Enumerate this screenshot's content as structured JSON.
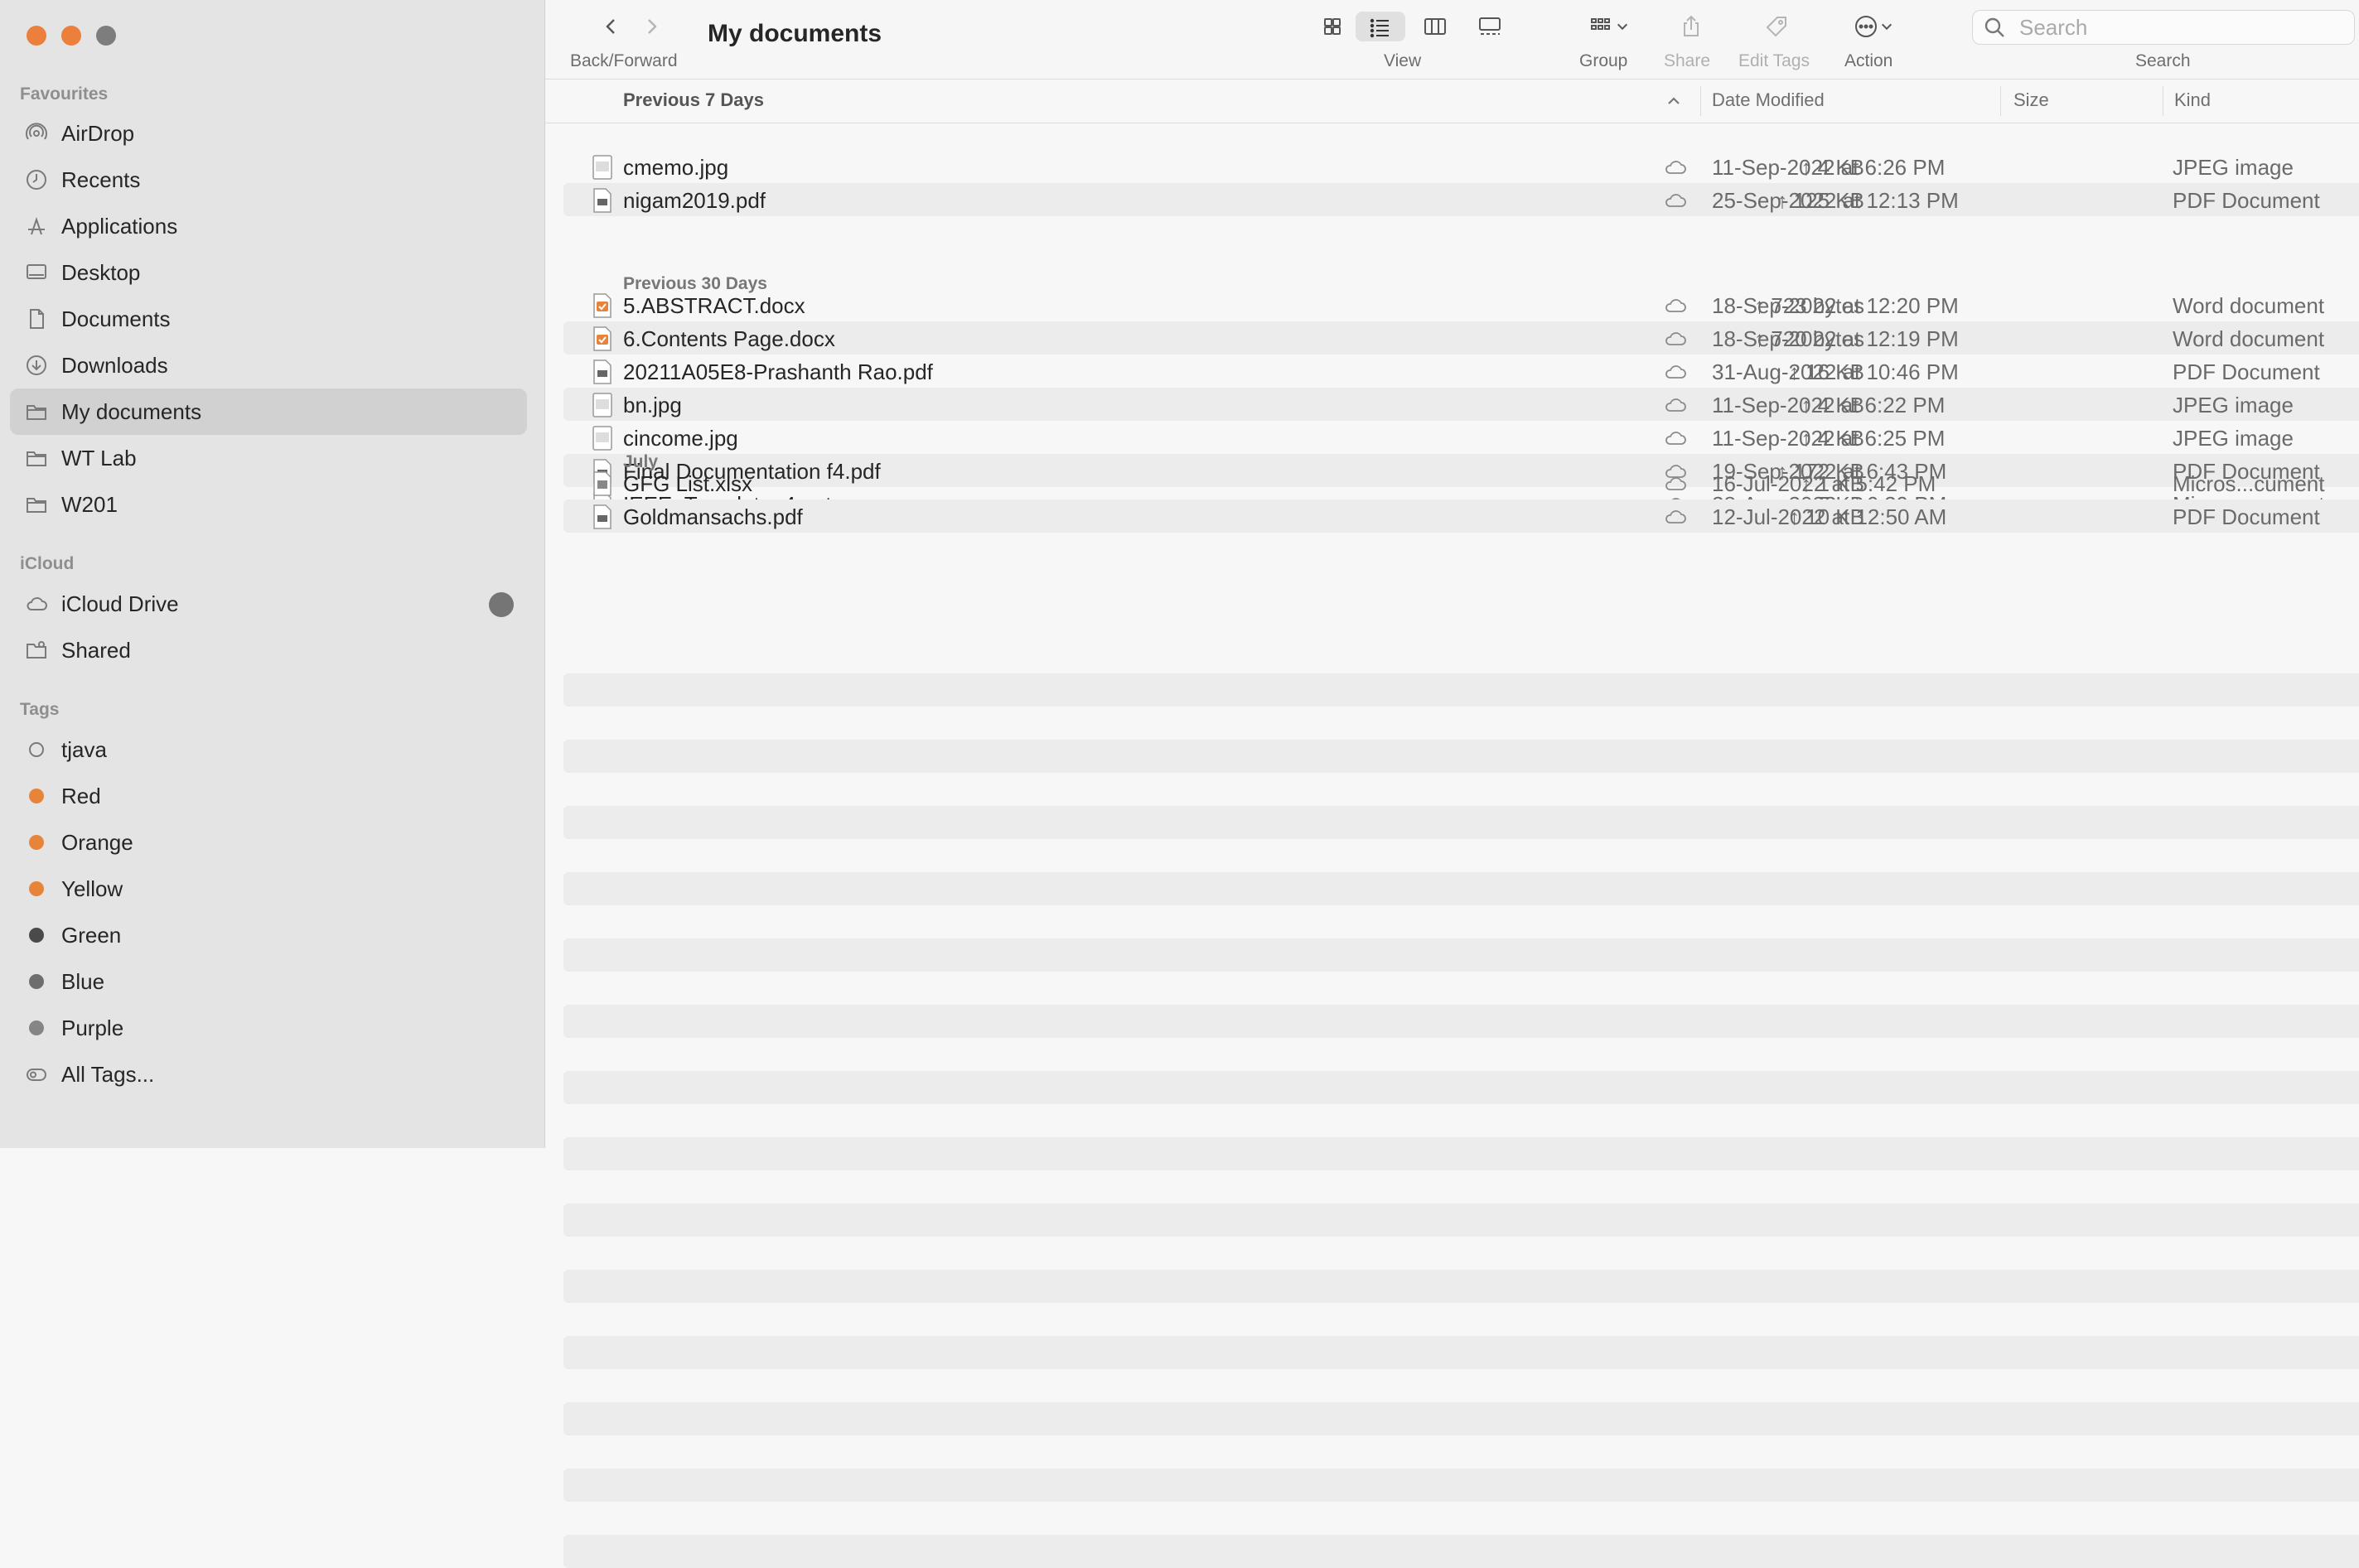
{
  "window": {
    "title": "My documents",
    "traffic_lights": [
      "close",
      "minimize",
      "zoom"
    ]
  },
  "sidebar": {
    "favourites_label": "Favourites",
    "favourites": [
      {
        "label": "AirDrop",
        "icon": "airdrop-icon"
      },
      {
        "label": "Recents",
        "icon": "clock-icon"
      },
      {
        "label": "Applications",
        "icon": "applications-icon"
      },
      {
        "label": "Desktop",
        "icon": "desktop-icon"
      },
      {
        "label": "Documents",
        "icon": "document-icon"
      },
      {
        "label": "Downloads",
        "icon": "download-icon"
      },
      {
        "label": "My documents",
        "icon": "folder-icon",
        "selected": true
      },
      {
        "label": "WT Lab",
        "icon": "folder-icon"
      },
      {
        "label": "W201",
        "icon": "folder-icon"
      }
    ],
    "icloud_label": "iCloud",
    "icloud": [
      {
        "label": "iCloud Drive",
        "icon": "cloud-icon"
      },
      {
        "label": "Shared",
        "icon": "shared-folder-icon"
      }
    ],
    "tags_label": "Tags",
    "tags": [
      {
        "label": "tjava",
        "color": "hollow"
      },
      {
        "label": "Red",
        "color": "#e8833a"
      },
      {
        "label": "Orange",
        "color": "#e8833a"
      },
      {
        "label": "Yellow",
        "color": "#e8833a"
      },
      {
        "label": "Green",
        "color": "#4a4a4a"
      },
      {
        "label": "Blue",
        "color": "#6e6e6e"
      },
      {
        "label": "Purple",
        "color": "#858585"
      },
      {
        "label": "All Tags...",
        "color": "all"
      }
    ]
  },
  "toolbar": {
    "back_forward_label": "Back/Forward",
    "view_label": "View",
    "group_label": "Group",
    "share_label": "Share",
    "edit_tags_label": "Edit Tags",
    "action_label": "Action",
    "search_label": "Search",
    "search_placeholder": "Search",
    "active_view": "list"
  },
  "columns": {
    "name": "Previous 7 Days",
    "date": "Date Modified",
    "size": "Size",
    "kind": "Kind"
  },
  "groups": [
    {
      "label": "Previous 7 Days",
      "files": [
        {
          "name": "cmemo.jpg",
          "date": "11-Sep-2022 at 6:26 PM",
          "size": "↑ 4 KB",
          "kind": "JPEG image",
          "icon": "image-file-icon"
        },
        {
          "name": "nigam2019.pdf",
          "date": "25-Sep-2022 at 12:13 PM",
          "size": "↑ 125 KB",
          "kind": "PDF Document",
          "icon": "pdf-file-icon"
        }
      ]
    },
    {
      "label": "Previous 30 Days",
      "files": [
        {
          "name": "5.ABSTRACT.docx",
          "date": "18-Sep-2022 at 12:20 PM",
          "size": "↑ 723 bytes",
          "kind": "Word document",
          "icon": "word-file-icon"
        },
        {
          "name": "6.Contents Page.docx",
          "date": "18-Sep-2022 at 12:19 PM",
          "size": "↑ 720 bytes",
          "kind": "Word document",
          "icon": "word-file-icon"
        },
        {
          "name": "20211A05E8-Prashanth Rao.pdf",
          "date": "31-Aug-2022 at 10:46 PM",
          "size": "↑ 16 KB",
          "kind": "PDF Document",
          "icon": "pdf-file-icon"
        },
        {
          "name": "bn.jpg",
          "date": "11-Sep-2022 at 6:22 PM",
          "size": "↑ 4 KB",
          "kind": "JPEG image",
          "icon": "image-file-icon"
        },
        {
          "name": "cincome.jpg",
          "date": "11-Sep-2022 at 6:25 PM",
          "size": "↑ 4 KB",
          "kind": "JPEG image",
          "icon": "image-file-icon"
        },
        {
          "name": "Final Documentation f4.pdf",
          "date": "19-Sep-2022 at 6:43 PM",
          "size": "↑ 172 KB",
          "kind": "PDF Document",
          "icon": "pdf-file-icon"
        },
        {
          "name": "IEEE_Template_4.ppt",
          "date": "28-Aug-2022 at 6:39 PM",
          "size": "↑ 7 KB",
          "kind": "Micros...cument",
          "icon": "ppt-file-icon"
        }
      ]
    },
    {
      "label": "July",
      "files": [
        {
          "name": "GFG List.xlsx",
          "date": "16-Jul-2022 at 5:42 PM",
          "size": "↑ 1 KB",
          "kind": "Micros...cument",
          "icon": "excel-file-icon"
        },
        {
          "name": "Goldmansachs.pdf",
          "date": "12-Jul-2022 at 12:50 AM",
          "size": "↑ 10 KB",
          "kind": "PDF Document",
          "icon": "pdf-file-icon"
        }
      ]
    }
  ]
}
